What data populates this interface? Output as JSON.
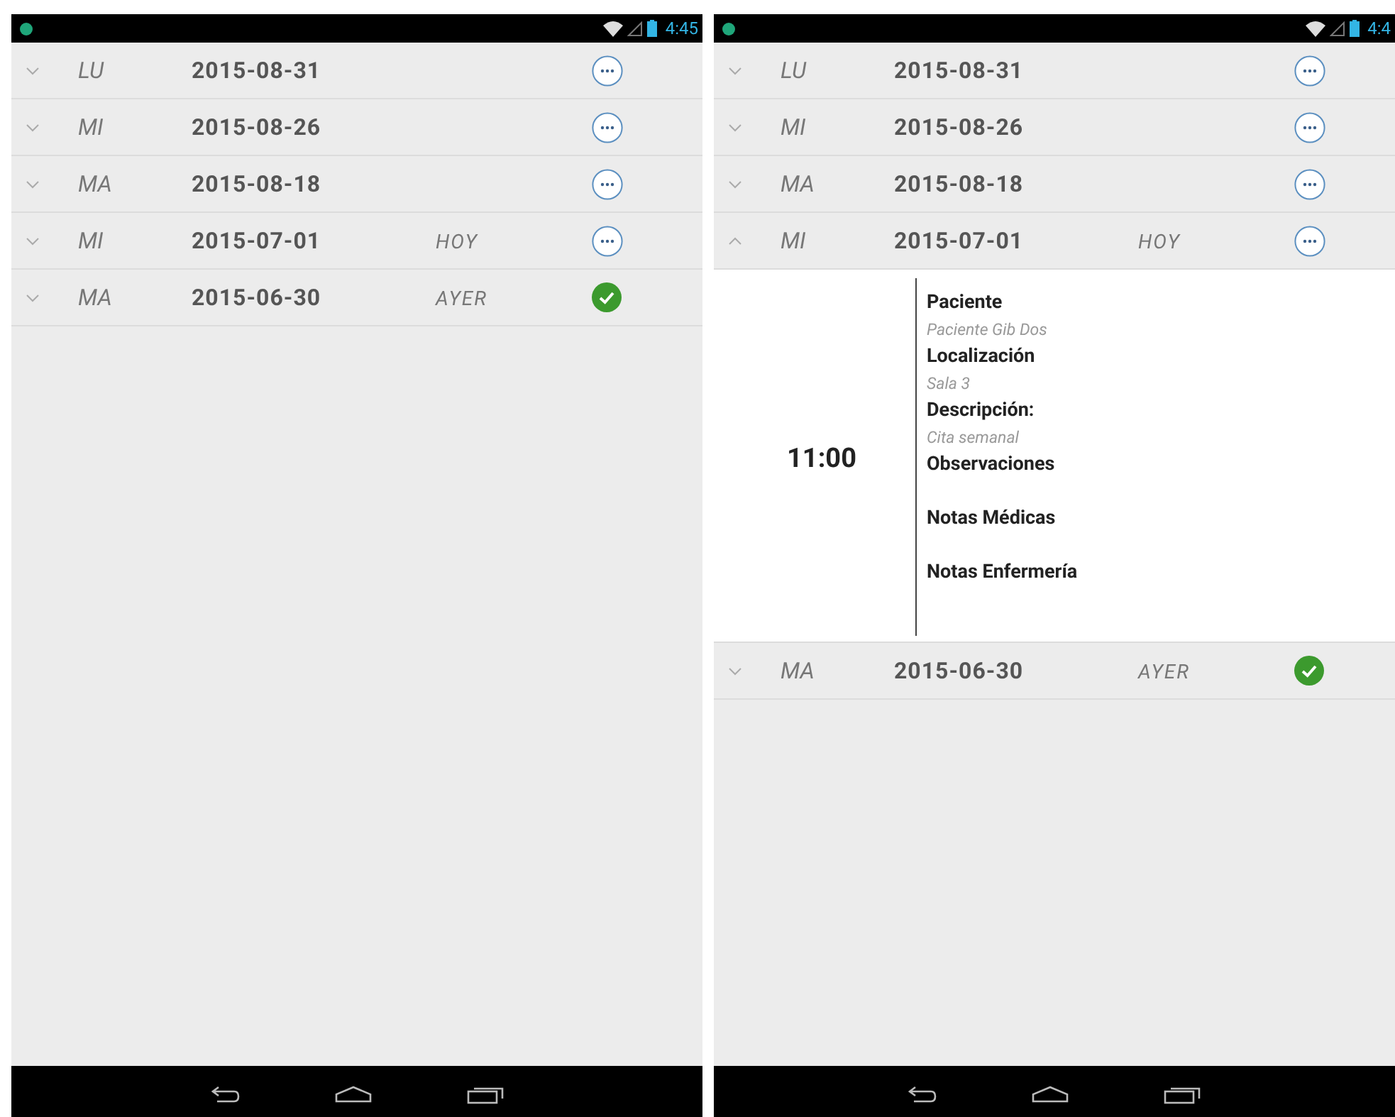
{
  "screens": [
    {
      "status_bar": {
        "time": "4:45"
      },
      "rows": [
        {
          "weekday": "LU",
          "date": "2015-08-31",
          "expanded": false,
          "completed": false
        },
        {
          "weekday": "MI",
          "date": "2015-08-26",
          "expanded": false,
          "completed": false
        },
        {
          "weekday": "MA",
          "date": "2015-08-18",
          "expanded": false,
          "completed": false
        },
        {
          "weekday": "MI",
          "date": "2015-07-01",
          "tag": "HOY",
          "expanded": false,
          "completed": false
        },
        {
          "weekday": "MA",
          "date": "2015-06-30",
          "tag": "AYER",
          "expanded": false,
          "completed": true
        }
      ]
    },
    {
      "status_bar": {
        "time": "4:4"
      },
      "rows": [
        {
          "weekday": "LU",
          "date": "2015-08-31",
          "expanded": false,
          "completed": false
        },
        {
          "weekday": "MI",
          "date": "2015-08-26",
          "expanded": false,
          "completed": false
        },
        {
          "weekday": "MA",
          "date": "2015-08-18",
          "expanded": false,
          "completed": false
        },
        {
          "weekday": "MI",
          "date": "2015-07-01",
          "tag": "HOY",
          "expanded": true,
          "completed": false,
          "detail": {
            "time": "11:00",
            "fields": [
              {
                "label": "Paciente",
                "value": "Paciente Gib Dos"
              },
              {
                "label": "Localización",
                "value": "Sala 3"
              },
              {
                "label": "Descripción:",
                "value": "Cita semanal"
              },
              {
                "label": "Observaciones"
              },
              {
                "label": "Notas Médicas"
              },
              {
                "label": "Notas Enfermería"
              }
            ]
          }
        },
        {
          "weekday": "MA",
          "date": "2015-06-30",
          "tag": "AYER",
          "expanded": false,
          "completed": true
        }
      ]
    }
  ]
}
